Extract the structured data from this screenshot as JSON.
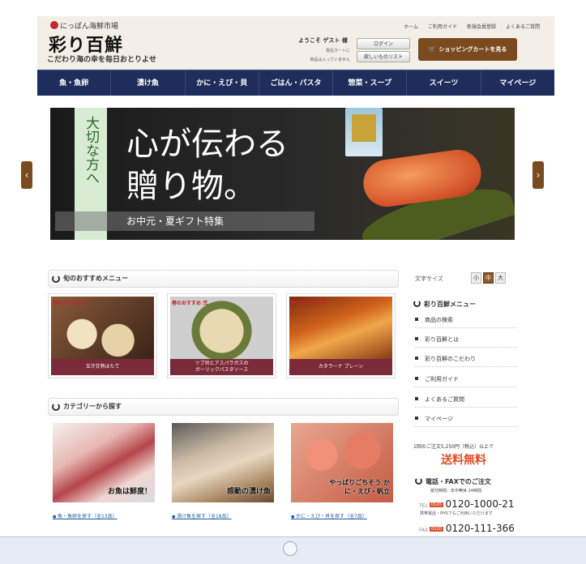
{
  "header": {
    "logo_top": "にっぽん海鮮市場",
    "logo_main": "彩り百鮮",
    "tagline": "こだわり海の幸を毎日おとりよせ",
    "top_links": [
      "ホーム",
      "ご利用ガイド",
      "新規会員登録",
      "よくあるご質問"
    ],
    "welcome": "ようこそ ゲスト 様",
    "cart_note_1": "現在カートに",
    "cart_note_2": "商品は入っていません",
    "login_label": "ログイン",
    "wishlist_label": "欲しいものリスト",
    "cart_button_label": "ショッピングカートを見る"
  },
  "nav": {
    "items": [
      "魚・魚卵",
      "漬け魚",
      "かに・えび・貝",
      "ごはん・パスタ",
      "惣菜・スープ",
      "スイーツ",
      "マイページ"
    ]
  },
  "hero": {
    "band_text": "大切な方へ",
    "line1": "心が伝わる",
    "line2": "贈り物。",
    "subtitle": "お中元・夏ギフト特集",
    "prev_label": "‹",
    "next_label": "›"
  },
  "recommend": {
    "title": "旬のおすすめメニュー",
    "cards": [
      {
        "tag": "春のおすすめ 壱",
        "caption": "玉冷甘熟ほたて"
      },
      {
        "tag": "春のおすすめ 弐",
        "caption": "ツブ貝とアスパラガスの\nガーリックパスタソース"
      },
      {
        "tag": "春のおすすめ 参",
        "caption": "カタラーナ プレーン"
      }
    ]
  },
  "category": {
    "title": "カテゴリーから探す",
    "tiles": [
      {
        "tag": "お魚は鮮度！",
        "link": "魚・魚卵を探す（全13品）"
      },
      {
        "tag": "感動の漬け魚",
        "link": "漬け魚を探す（全18品）"
      },
      {
        "tag": "やっぱりごちそう かに・えび・帆立",
        "link": "かに・えび・貝を探す（全7品）"
      }
    ]
  },
  "sidebar": {
    "font_size_label": "文字サイズ",
    "font_sizes": [
      "小",
      "中",
      "大"
    ],
    "menu_title": "彩り百鮮メニュー",
    "menu_items": [
      "商品の検索",
      "彩り百鮮とは",
      "彩り百鮮のこだわり",
      "ご利用ガイド",
      "よくあるご質問",
      "マイページ"
    ],
    "shipping_note": "1回のご注文5,250円（税込）以上で",
    "shipping_free": "送料無料",
    "contact_title": "電話・FAXでのご注文",
    "contact_hours": "受付時間：年中無休 24時間",
    "tel_label": "TEL",
    "tel_tag": "0120",
    "tel_number": "0120-1000-21",
    "tel_note": "携帯電話・PHSでもご利用いただけます",
    "fax_label": "FAX",
    "fax_tag": "0120",
    "fax_number": "0120-111-366"
  },
  "colors": {
    "nav_bg": "#1f2d5c",
    "accent_brown": "#7a4b1f",
    "caption_bg": "#7a2a38",
    "free_shipping": "#e0502a"
  }
}
